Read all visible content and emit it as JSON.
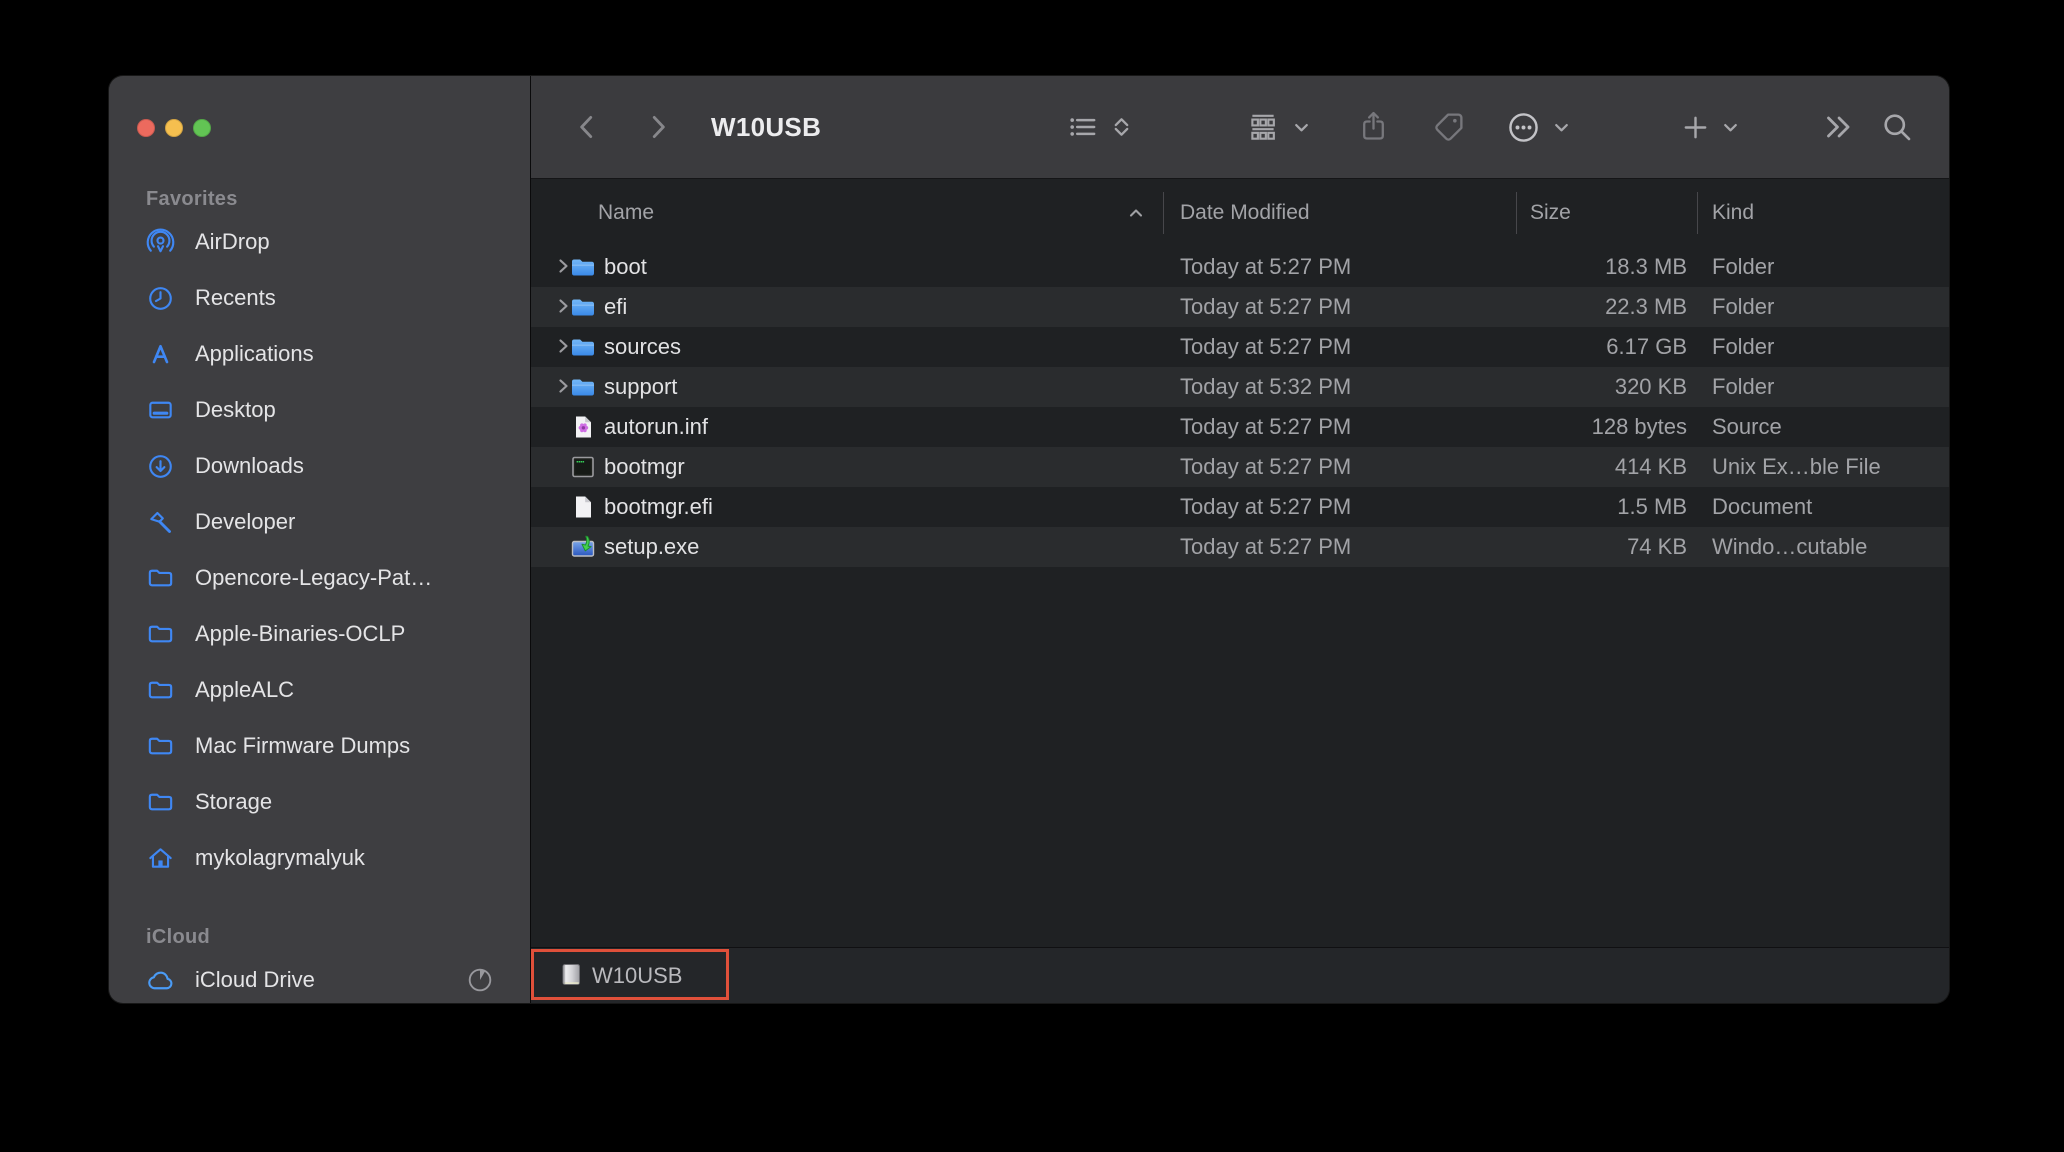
{
  "window": {
    "title": "W10USB"
  },
  "toolbar": {
    "icons": [
      "back",
      "forward",
      "view-as-list",
      "group-by",
      "share",
      "tag",
      "more-actions",
      "new-item",
      "more-toolbar-items",
      "search"
    ]
  },
  "sidebar": {
    "sections": [
      {
        "label": "Favorites",
        "items": [
          {
            "label": "AirDrop",
            "icon": "airdrop"
          },
          {
            "label": "Recents",
            "icon": "clock"
          },
          {
            "label": "Applications",
            "icon": "appstore"
          },
          {
            "label": "Desktop",
            "icon": "desktop"
          },
          {
            "label": "Downloads",
            "icon": "download"
          },
          {
            "label": "Developer",
            "icon": "hammer"
          },
          {
            "label": "Opencore-Legacy-Pat…",
            "icon": "folder"
          },
          {
            "label": "Apple-Binaries-OCLP",
            "icon": "folder"
          },
          {
            "label": "AppleALC",
            "icon": "folder"
          },
          {
            "label": "Mac Firmware Dumps",
            "icon": "folder"
          },
          {
            "label": "Storage",
            "icon": "folder"
          },
          {
            "label": "mykolagrymalyuk",
            "icon": "home"
          }
        ]
      },
      {
        "label": "iCloud",
        "items": [
          {
            "label": "iCloud Drive",
            "icon": "cloud",
            "trailing": "sync-progress"
          }
        ]
      }
    ]
  },
  "columns": {
    "name": "Name",
    "date": "Date Modified",
    "size": "Size",
    "kind": "Kind"
  },
  "files": {
    "rows": [
      {
        "name": "boot",
        "date": "Today at 5:27 PM",
        "size": "18.3 MB",
        "kind": "Folder",
        "icon": "folder",
        "expandable": true
      },
      {
        "name": "efi",
        "date": "Today at 5:27 PM",
        "size": "22.3 MB",
        "kind": "Folder",
        "icon": "folder",
        "expandable": true
      },
      {
        "name": "sources",
        "date": "Today at 5:27 PM",
        "size": "6.17 GB",
        "kind": "Folder",
        "icon": "folder",
        "expandable": true
      },
      {
        "name": "support",
        "date": "Today at 5:32 PM",
        "size": "320 KB",
        "kind": "Folder",
        "icon": "folder",
        "expandable": true
      },
      {
        "name": "autorun.inf",
        "date": "Today at 5:27 PM",
        "size": "128 bytes",
        "kind": "Source",
        "icon": "source",
        "expandable": false
      },
      {
        "name": "bootmgr",
        "date": "Today at 5:27 PM",
        "size": "414 KB",
        "kind": "Unix Ex…ble File",
        "icon": "unix",
        "expandable": false
      },
      {
        "name": "bootmgr.efi",
        "date": "Today at 5:27 PM",
        "size": "1.5 MB",
        "kind": "Document",
        "icon": "doc",
        "expandable": false
      },
      {
        "name": "setup.exe",
        "date": "Today at 5:27 PM",
        "size": "74 KB",
        "kind": "Windo…cutable",
        "icon": "winexec",
        "expandable": false
      }
    ]
  },
  "statusbar": {
    "volume": "W10USB"
  },
  "colors": {
    "accent_blue": "#3f87f3",
    "annotation_red": "#e0503a",
    "traffic_red": "#ec6a5e",
    "traffic_yellow": "#f5bf4f",
    "traffic_green": "#62c454",
    "sidebar_bg": "#3e3e41",
    "row_alt_bg": "#2a2c2e"
  }
}
